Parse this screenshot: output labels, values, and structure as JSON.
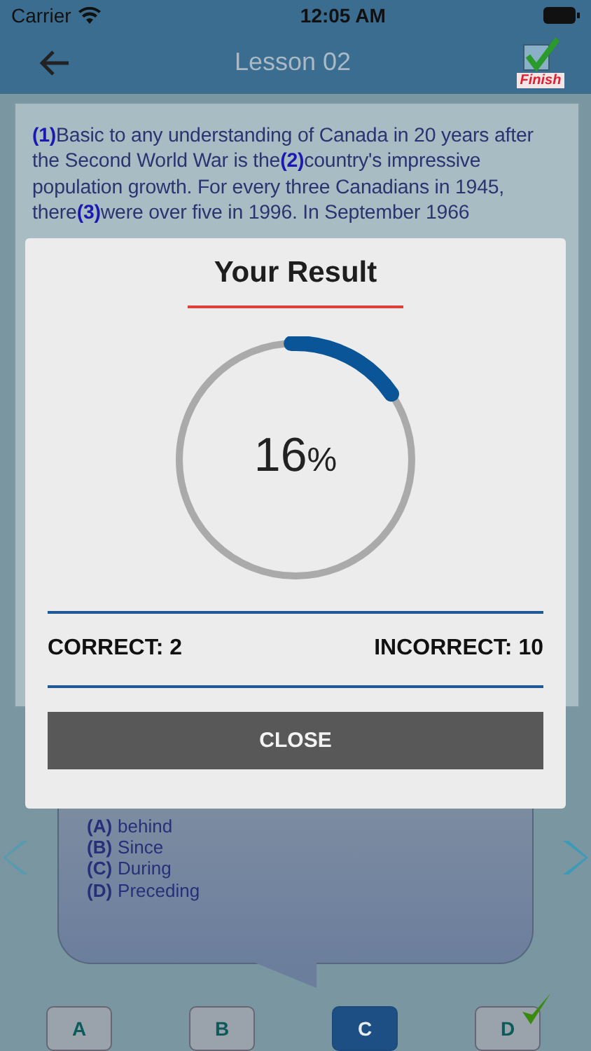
{
  "status_bar": {
    "carrier": "Carrier",
    "time": "12:05 AM"
  },
  "nav_bar": {
    "title": "Lesson 02",
    "finish_label": "Finish"
  },
  "passage": {
    "text": "**(1)**Basic to any understanding of Canada in 20 years after the Second World War is the**(2)**country's impressive population growth. For every three Canadians in 1945, there**(3)**were over five in 1996. In September 1966"
  },
  "question": {
    "options": [
      {
        "letter": "(A)",
        "text": "behind"
      },
      {
        "letter": "(B)",
        "text": "Since"
      },
      {
        "letter": "(C)",
        "text": "During"
      },
      {
        "letter": "(D)",
        "text": "Preceding"
      }
    ]
  },
  "answers": [
    {
      "label": "A",
      "selected": false,
      "correct": false
    },
    {
      "label": "B",
      "selected": false,
      "correct": false
    },
    {
      "label": "C",
      "selected": true,
      "correct": false
    },
    {
      "label": "D",
      "selected": false,
      "correct": true
    }
  ],
  "result": {
    "title": "Your Result",
    "percent": "16",
    "percent_sign": "%",
    "level": 0.16,
    "correct": "CORRECT: 2",
    "incorrect": "INCORRECT: 10",
    "close": "CLOSE"
  }
}
